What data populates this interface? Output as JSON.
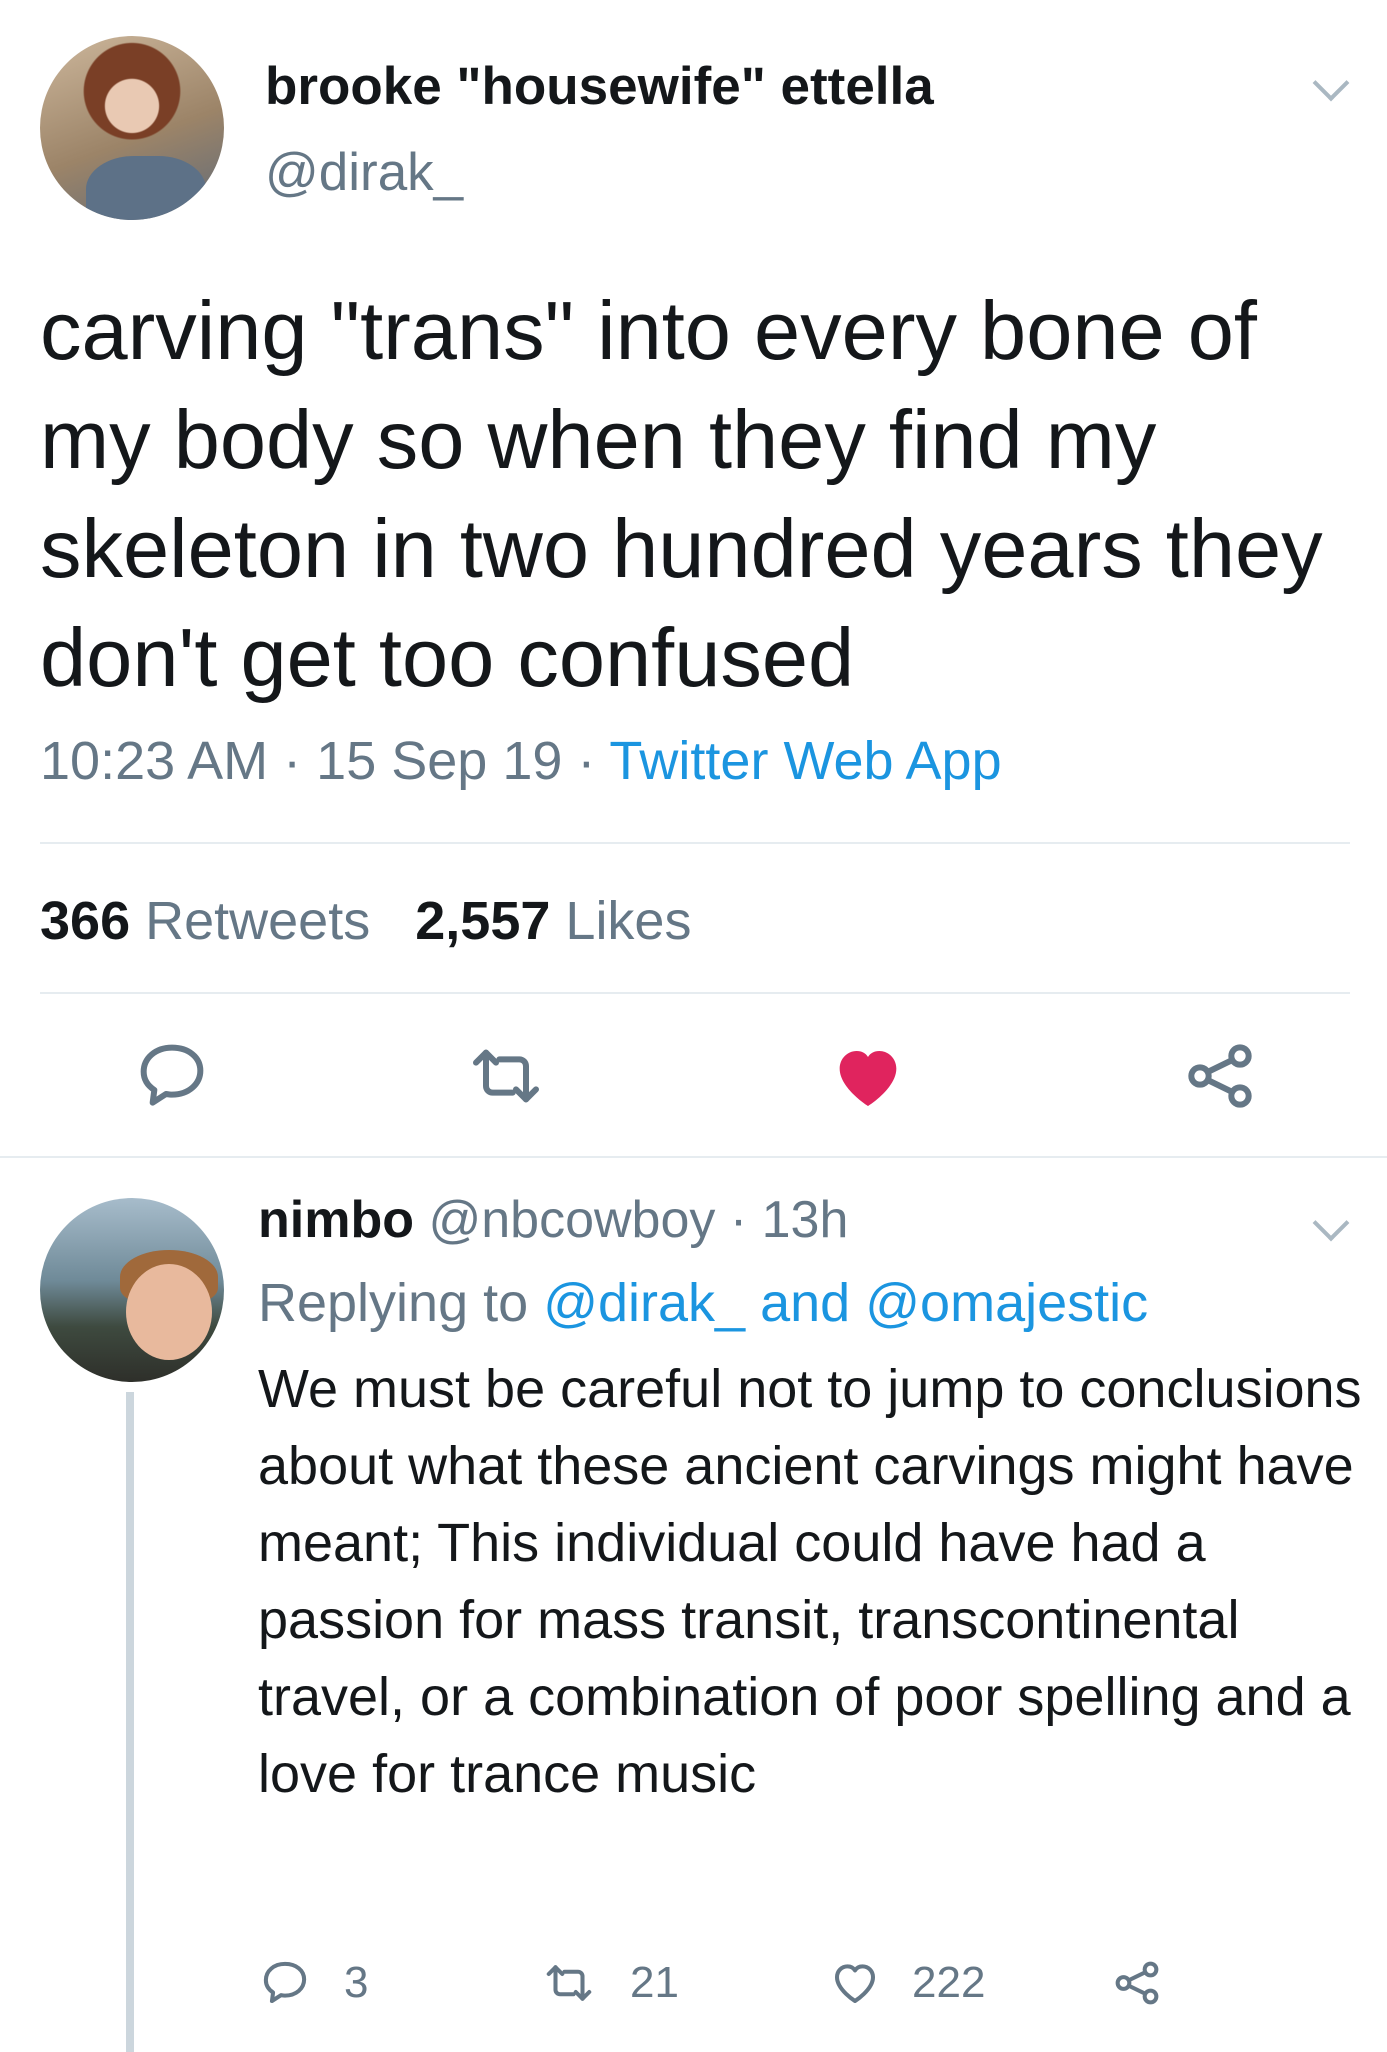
{
  "tweet": {
    "author_name": "brooke \"housewife\" ettella",
    "author_handle": "@dirak_",
    "text": "carving \"trans\" into every bone of my body so when they find my skeleton in two hundred years they don't get too confused",
    "time": "10:23 AM",
    "separator": "·",
    "date": "15 Sep 19",
    "source": "Twitter Web App",
    "retweet_count": "366",
    "retweet_label": "Retweets",
    "like_count": "2,557",
    "like_label": "Likes",
    "liked": true,
    "actions": [
      "comment-icon",
      "retweet-icon",
      "heart-filled-icon",
      "share-icon"
    ],
    "colors": {
      "link": "#1b95e0",
      "like": "#e0245e",
      "muted": "#657786"
    }
  },
  "reply": {
    "author_name": "nimbo",
    "author_handle": "@nbcowboy",
    "separator": "·",
    "age": "13h",
    "replying_prefix": "Replying to",
    "replying_to_1": "@dirak_",
    "replying_and": "and",
    "replying_to_2": "@omajestic",
    "text": "We must be careful not to jump to conclusions about what these ancient carvings might have meant; This individual could have had a passion for mass transit, transcontinental travel, or a combination of poor spelling and a love for trance music",
    "reply_count": "3",
    "retweet_count": "21",
    "like_count": "222"
  }
}
